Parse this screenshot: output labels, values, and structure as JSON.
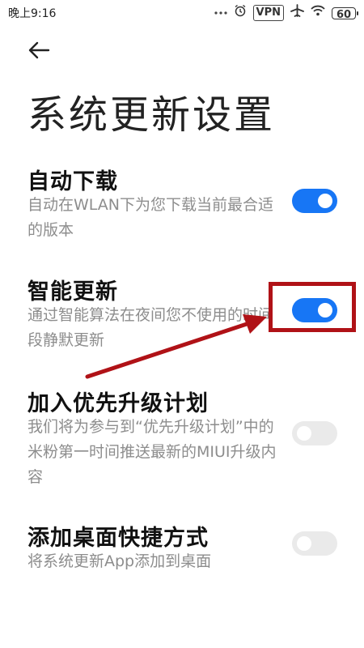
{
  "status_bar": {
    "time": "晚上9:16",
    "vpn": "VPN",
    "battery": "60"
  },
  "header": {
    "title": "系统更新设置"
  },
  "settings": [
    {
      "title": "自动下载",
      "description": "自动在WLAN下为您下载当前最合适的版本",
      "enabled": true
    },
    {
      "title": "智能更新",
      "description": "通过智能算法在夜间您不使用的时间段静默更新",
      "enabled": true
    },
    {
      "title": "加入优先升级计划",
      "description": "我们将为参与到“优先升级计划”中的米粉第一时间推送最新的MIUI升级内容",
      "enabled": false
    },
    {
      "title": "添加桌面快捷方式",
      "description": "将系统更新App添加到桌面",
      "enabled": false
    }
  ],
  "colors": {
    "toggle_on": "#1776f5",
    "toggle_off": "#eaeaea",
    "annotation": "#b01217"
  },
  "icons": [
    "back-arrow-icon",
    "dots-icon",
    "alarm-icon",
    "airplane-icon",
    "wifi-icon"
  ]
}
